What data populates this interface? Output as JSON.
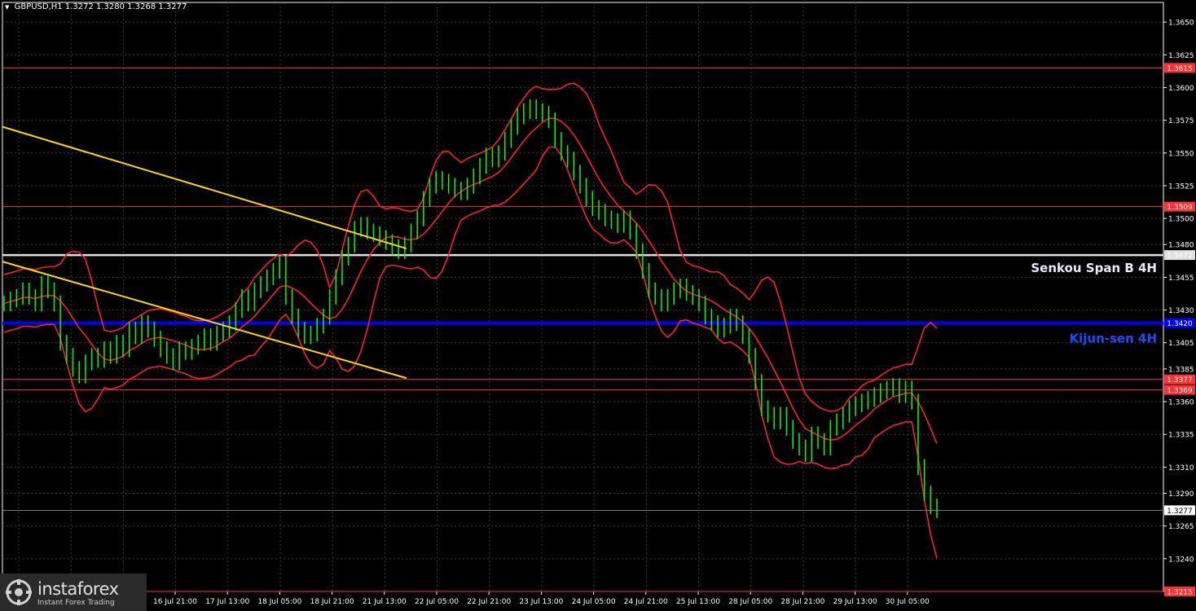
{
  "header": {
    "symbol": "GBPUSD,H1",
    "ohlc": "1.3272 1.3280 1.3268 1.3277"
  },
  "logo": {
    "name": "instaforex",
    "tagline": "Instant Forex Trading"
  },
  "colors": {
    "background": "#000000",
    "grid": "#3a3a3a",
    "candle": "#00ff00",
    "bollinger": "#ff2020",
    "trendline": "#ffd700",
    "level": "#ff3030",
    "kijun": "#0000ff",
    "senkou": "#e0e0e0",
    "axis_text": "#ffffff"
  },
  "chart_data": {
    "type": "line",
    "title": "GBPUSD,H1",
    "ylim": [
      1.3215,
      1.3665
    ],
    "grid": true,
    "y_ticks": [
      "1.3650",
      "1.3625",
      "1.3600",
      "1.3575",
      "1.3550",
      "1.3525",
      "1.3500",
      "1.3480",
      "1.3455",
      "1.3430",
      "1.3405",
      "1.3385",
      "1.3360",
      "1.3335",
      "1.3310",
      "1.3290",
      "1.3265",
      "1.3240",
      "1.3215"
    ],
    "x_ticks": [
      "16 Jul 21:00",
      "17 Jul 13:00",
      "18 Jul 05:00",
      "18 Jul 21:00",
      "21 Jul 13:00",
      "22 Jul 05:00",
      "22 Jul 21:00",
      "23 Jul 13:00",
      "24 Jul 05:00",
      "24 Jul 21:00",
      "25 Jul 13:00",
      "28 Jul 05:00",
      "28 Jul 21:00",
      "29 Jul 13:00",
      "30 Jul 05:00"
    ],
    "price_series": {
      "name": "GBPUSD",
      "values": [
        1.3435,
        1.3438,
        1.344,
        1.3445,
        1.344,
        1.3435,
        1.345,
        1.3445,
        1.3435,
        1.3405,
        1.3395,
        1.3385,
        1.338,
        1.339,
        1.3395,
        1.3392,
        1.34,
        1.3395,
        1.3405,
        1.34,
        1.3415,
        1.341,
        1.342,
        1.3415,
        1.3408,
        1.34,
        1.3395,
        1.339,
        1.34,
        1.3398,
        1.3402,
        1.3405,
        1.341,
        1.3405,
        1.3412,
        1.3415,
        1.342,
        1.343,
        1.344,
        1.3435,
        1.3445,
        1.345,
        1.3455,
        1.346,
        1.3465,
        1.344,
        1.3425,
        1.3415,
        1.341,
        1.3412,
        1.3418,
        1.3425,
        1.344,
        1.3455,
        1.347,
        1.348,
        1.3492,
        1.3495,
        1.349,
        1.3488,
        1.3485,
        1.3482,
        1.3478,
        1.3475,
        1.348,
        1.349,
        1.35,
        1.3515,
        1.3525,
        1.353,
        1.3528,
        1.3525,
        1.3522,
        1.352,
        1.3525,
        1.3532,
        1.354,
        1.3548,
        1.3545,
        1.355,
        1.356,
        1.357,
        1.3578,
        1.3582,
        1.3585,
        1.3582,
        1.358,
        1.3575,
        1.356,
        1.355,
        1.3545,
        1.3535,
        1.3525,
        1.3515,
        1.3508,
        1.3505,
        1.35,
        1.3498,
        1.3495,
        1.35,
        1.349,
        1.3475,
        1.346,
        1.3445,
        1.344,
        1.3435,
        1.344,
        1.3445,
        1.3448,
        1.3443,
        1.344,
        1.3435,
        1.3425,
        1.342,
        1.3415,
        1.3418,
        1.3425,
        1.342,
        1.341,
        1.3395,
        1.3375,
        1.3355,
        1.335,
        1.3345,
        1.335,
        1.334,
        1.333,
        1.3325,
        1.332,
        1.3335,
        1.333,
        1.3325,
        1.334,
        1.3345,
        1.335,
        1.3355,
        1.3358,
        1.336,
        1.3362,
        1.3365,
        1.3368,
        1.337,
        1.3372,
        1.3365,
        1.337,
        1.336,
        1.331,
        1.329,
        1.328,
        1.3277
      ]
    },
    "horizontal_levels": [
      {
        "value": 1.3615,
        "label": "1.3615",
        "kind": "resistance"
      },
      {
        "value": 1.3509,
        "label": "1.3509",
        "kind": "resistance"
      },
      {
        "value": 1.3472,
        "label": "1.3472",
        "kind": "senkou"
      },
      {
        "value": 1.342,
        "label": "1.3420",
        "kind": "kijun"
      },
      {
        "value": 1.3377,
        "label": "1.3377",
        "kind": "support"
      },
      {
        "value": 1.3369,
        "label": "1.3369",
        "kind": "support"
      },
      {
        "value": 1.3277,
        "label": "1.3277",
        "kind": "current"
      },
      {
        "value": 1.3215,
        "label": "1.3215",
        "kind": "support"
      }
    ],
    "line_labels": {
      "senkou": "Senkou Span B 4H",
      "kijun": "Kijun-sen 4H"
    },
    "trendlines": [
      {
        "from": [
          0,
          1.357
        ],
        "to": [
          0.348,
          1.3477
        ]
      },
      {
        "from": [
          0,
          1.3467
        ],
        "to": [
          0.348,
          1.3378
        ]
      }
    ]
  }
}
